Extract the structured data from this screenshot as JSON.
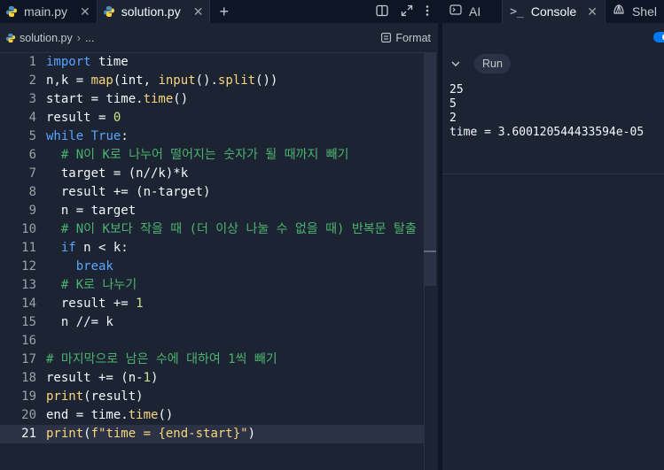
{
  "tabs": [
    {
      "label": "main.py",
      "active": false
    },
    {
      "label": "solution.py",
      "active": true
    }
  ],
  "breadcrumb": {
    "file": "solution.py",
    "more": "...",
    "format_label": "Format"
  },
  "editor": {
    "current_line": 21,
    "lines": [
      {
        "n": "1",
        "text": "import time"
      },
      {
        "n": "2",
        "text": "n,k = map(int, input().split())"
      },
      {
        "n": "3",
        "text": "start = time.time()"
      },
      {
        "n": "4",
        "text": "result = 0"
      },
      {
        "n": "5",
        "text": "while True:"
      },
      {
        "n": "6",
        "text": "  # N이 K로 나누어 떨어지는 숫자가 될 때까지 빼기"
      },
      {
        "n": "7",
        "text": "  target = (n//k)*k"
      },
      {
        "n": "8",
        "text": "  result += (n-target)"
      },
      {
        "n": "9",
        "text": "  n = target"
      },
      {
        "n": "10",
        "text": "  # N이 K보다 작을 때 (더 이상 나눌 수 없을 때) 반복문 탈출"
      },
      {
        "n": "11",
        "text": "  if n < k:"
      },
      {
        "n": "12",
        "text": "    break"
      },
      {
        "n": "13",
        "text": "  # K로 나누기"
      },
      {
        "n": "14",
        "text": "  result += 1"
      },
      {
        "n": "15",
        "text": "  n //= k"
      },
      {
        "n": "16",
        "text": ""
      },
      {
        "n": "17",
        "text": "# 마지막으로 남은 수에 대하여 1씩 빼기"
      },
      {
        "n": "18",
        "text": "result += (n-1)"
      },
      {
        "n": "19",
        "text": "print(result)"
      },
      {
        "n": "20",
        "text": "end = time.time()"
      },
      {
        "n": "21",
        "text": "print(f\"time = {end-start}\")"
      }
    ]
  },
  "right_tabs": [
    {
      "label": "AI",
      "icon": "ai-icon"
    },
    {
      "label": "Console",
      "icon": "terminal-icon",
      "active": true
    },
    {
      "label": "Shel",
      "icon": "shell-icon"
    }
  ],
  "console": {
    "run_label": "Run",
    "output": [
      "25",
      "5",
      "2",
      "time = 3.600120544433594e-05"
    ]
  },
  "colors": {
    "accent": "#0079f2",
    "keyword": "#58a6ff",
    "function": "#f9d67a",
    "number": "#c4e88c",
    "comment": "#4cb36f"
  }
}
